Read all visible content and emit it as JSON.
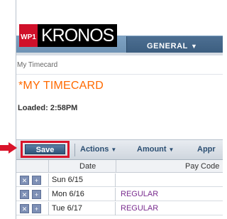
{
  "header": {
    "logo_wp": "WP1",
    "logo_brand": "KRONOS",
    "tab_label": "GENERAL"
  },
  "breadcrumb": "My Timecard",
  "page_title": "*MY TIMECARD",
  "loaded_text": "Loaded: 2:58PM",
  "toolbar": {
    "save_label": "Save",
    "actions_label": "Actions",
    "amount_label": "Amount",
    "approve_label": "Appr"
  },
  "table": {
    "columns": [
      "Date",
      "Pay Code"
    ],
    "rows": [
      {
        "date": "Sun 6/15",
        "pay_code": ""
      },
      {
        "date": "Mon 6/16",
        "pay_code": "REGULAR"
      },
      {
        "date": "Tue 6/17",
        "pay_code": "REGULAR"
      }
    ]
  },
  "colors": {
    "title": "#ff6a00",
    "highlight": "#d9142a",
    "pay_code": "#7a2d8f"
  }
}
